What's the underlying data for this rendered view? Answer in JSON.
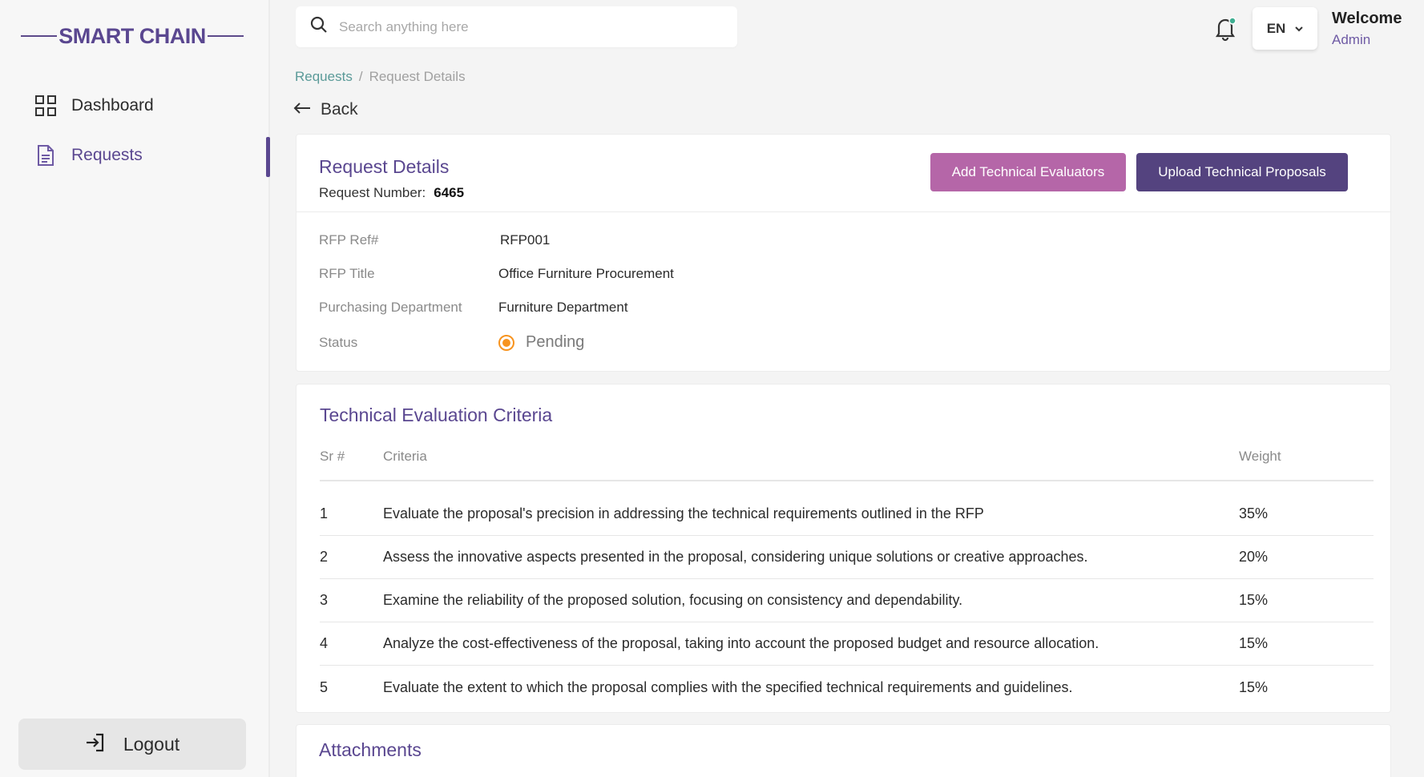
{
  "app": {
    "logo": "SMART CHAIN"
  },
  "sidebar": {
    "items": [
      {
        "label": "Dashboard",
        "icon": "grid-icon",
        "active": false
      },
      {
        "label": "Requests",
        "icon": "document-icon",
        "active": true
      }
    ],
    "logout_label": "Logout"
  },
  "topbar": {
    "search_placeholder": "Search anything here",
    "language": "EN",
    "welcome": "Welcome",
    "user": "Admin"
  },
  "breadcrumb": {
    "parent": "Requests",
    "separator": "/",
    "current": "Request Details"
  },
  "back_label": "Back",
  "request": {
    "title": "Request Details",
    "number_label": "Request Number:",
    "number": "6465",
    "buttons": {
      "add_evaluators": "Add Technical Evaluators",
      "upload_proposals": "Upload Technical Proposals"
    },
    "fields": [
      {
        "label": "RFP Ref#",
        "value": "RFP001"
      },
      {
        "label": "RFP Title",
        "value": "Office Furniture Procurement"
      },
      {
        "label": "Purchasing Department",
        "value": "Furniture Department"
      }
    ],
    "status_label": "Status",
    "status_value": "Pending",
    "status_color": "#f7931e"
  },
  "criteria": {
    "title": "Technical Evaluation Criteria",
    "columns": {
      "sr": "Sr #",
      "criteria": "Criteria",
      "weight": "Weight"
    },
    "rows": [
      {
        "sr": "1",
        "criteria": "Evaluate the proposal's precision in addressing the technical requirements outlined in the RFP",
        "weight": "35%"
      },
      {
        "sr": "2",
        "criteria": "Assess the innovative aspects presented in the proposal, considering unique solutions or creative approaches.",
        "weight": "20%"
      },
      {
        "sr": "3",
        "criteria": "Examine the reliability of the proposed solution, focusing on consistency and dependability.",
        "weight": "15%"
      },
      {
        "sr": "4",
        "criteria": "Analyze the cost-effectiveness of the proposal, taking into account the proposed budget and resource allocation.",
        "weight": "15%"
      },
      {
        "sr": "5",
        "criteria": "Evaluate the extent to which the proposal complies with the specified technical requirements and guidelines.",
        "weight": "15%"
      }
    ]
  },
  "attachments": {
    "title": "Attachments"
  },
  "colors": {
    "brand": "#5a4790",
    "accent_pink": "#b566a8",
    "accent_dark": "#54437f",
    "breadcrumb_link": "#5a9a98"
  }
}
